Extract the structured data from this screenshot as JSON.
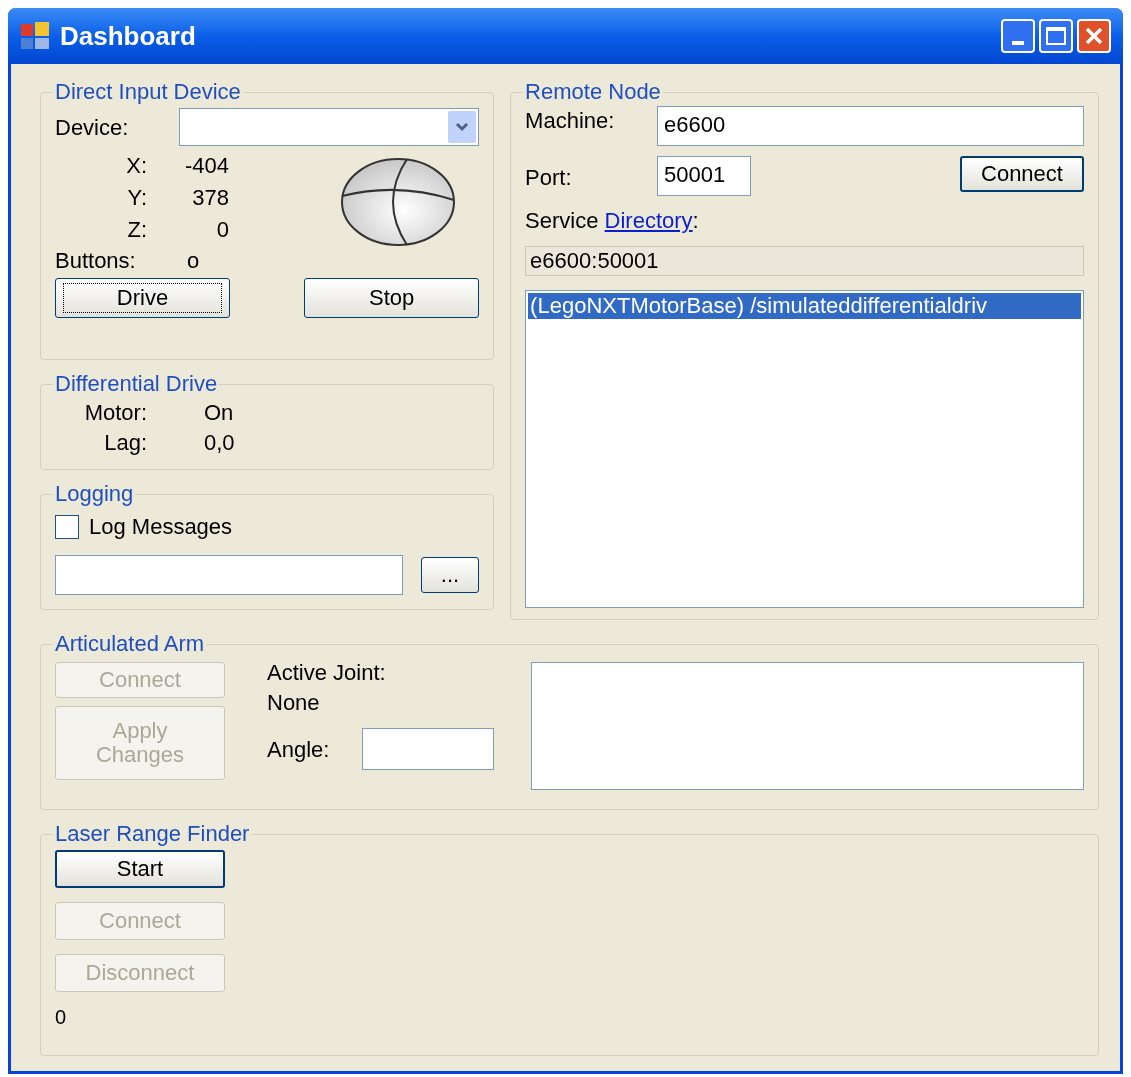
{
  "window": {
    "title": "Dashboard"
  },
  "direct_input": {
    "title": "Direct Input Device",
    "device_label": "Device:",
    "axes": [
      {
        "label": "X:",
        "value": "-404"
      },
      {
        "label": "Y:",
        "value": "378"
      },
      {
        "label": "Z:",
        "value": "0"
      }
    ],
    "buttons_label": "Buttons:",
    "buttons_value": "o",
    "actions": [
      {
        "label": "Drive",
        "focused": true
      },
      {
        "label": "Stop",
        "focused": false
      }
    ]
  },
  "differential_drive": {
    "title": "Differential Drive",
    "rows": [
      {
        "label": "Motor:",
        "value": "On"
      },
      {
        "label": "Lag:",
        "value": "0,0"
      }
    ]
  },
  "logging": {
    "title": "Logging",
    "checkbox": {
      "label": "Log Messages",
      "checked": false
    },
    "browse_button": "..."
  },
  "remote_node": {
    "title": "Remote Node",
    "machine_label": "Machine:",
    "machine_value": "e6600",
    "port_label": "Port:",
    "port_value": "50001",
    "connect_button": "Connect",
    "service_prefix": "Service",
    "service_link": "Directory",
    "service_suffix": ":",
    "address": "e6600:50001",
    "services": [
      {
        "text": "(LegoNXTMotorBase) /simulateddifferentialdriv",
        "selected": true
      }
    ]
  },
  "articulated_arm": {
    "title": "Articulated Arm",
    "buttons": [
      {
        "label": "Connect",
        "disabled": true
      },
      {
        "label": "Apply Changes",
        "disabled": true
      }
    ],
    "active_joint_label": "Active Joint:",
    "active_joint_value": "None",
    "angle_label": "Angle:"
  },
  "laser_range_finder": {
    "title": "Laser Range Finder",
    "buttons": [
      {
        "label": "Start",
        "disabled": false
      },
      {
        "label": "Connect",
        "disabled": true
      },
      {
        "label": "Disconnect",
        "disabled": true
      }
    ],
    "reading": "0"
  }
}
